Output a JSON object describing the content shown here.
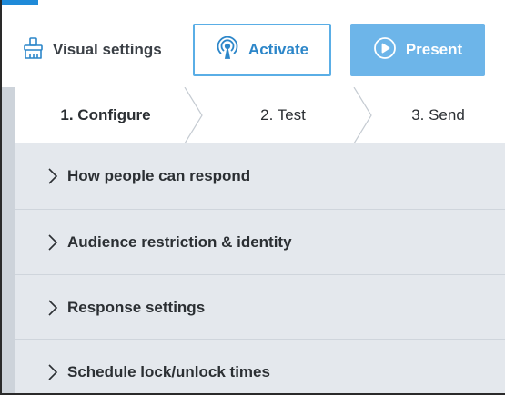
{
  "toolbar": {
    "visual_settings_label": "Visual settings",
    "activate_label": "Activate",
    "present_label": "Present",
    "icons": {
      "visual_settings": "paint-brush-icon",
      "activate": "broadcast-icon",
      "present": "play-circle-icon"
    }
  },
  "steps": [
    {
      "label": "1. Configure",
      "active": true
    },
    {
      "label": "2. Test",
      "active": false
    },
    {
      "label": "3. Send",
      "active": false
    }
  ],
  "sections": [
    {
      "label": "How people can respond",
      "expanded": false
    },
    {
      "label": "Audience restriction & identity",
      "expanded": false
    },
    {
      "label": "Response settings",
      "expanded": false
    },
    {
      "label": "Schedule lock/unlock times",
      "expanded": false
    }
  ],
  "colors": {
    "accent_blue": "#2c86c9",
    "present_button": "#6db5e9",
    "accordion_bg": "#e4e8ed",
    "rail": "#cdd3da"
  }
}
